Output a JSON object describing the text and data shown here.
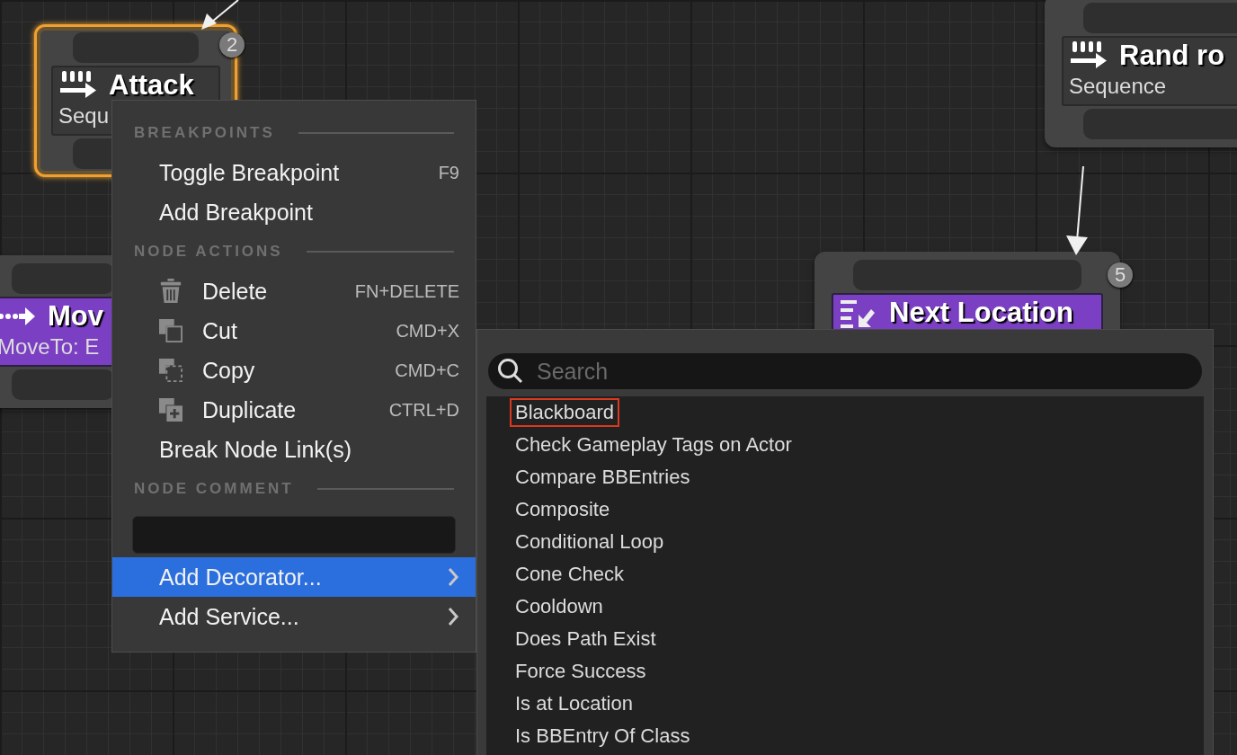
{
  "graph_nodes": [
    {
      "kind": "composite",
      "title": "Attack",
      "subtitle": "Sequ",
      "badge": "2",
      "selected": true
    },
    {
      "kind": "composite",
      "title": "Rand ro",
      "subtitle": "Sequence",
      "selected": false
    },
    {
      "kind": "move_task",
      "title": "Mov",
      "subtitle": "MoveTo: E",
      "selected": false
    },
    {
      "kind": "task",
      "title": "Next Location",
      "badge": "5",
      "selected": false
    }
  ],
  "context_menu": {
    "sections": [
      {
        "kind": "actions",
        "heading": "BREAKPOINTS",
        "items": [
          {
            "label": "Toggle Breakpoint",
            "shortcut": "F9",
            "with_icon": false,
            "selected": false
          },
          {
            "label": "Add Breakpoint",
            "with_icon": false,
            "selected": false
          }
        ]
      },
      {
        "kind": "actions",
        "heading": "NODE ACTIONS",
        "items": [
          {
            "label": "Delete",
            "shortcut": "FN+DELETE",
            "with_icon": true,
            "selected": false
          },
          {
            "label": "Cut",
            "shortcut": "CMD+X",
            "with_icon": true,
            "selected": false
          },
          {
            "label": "Copy",
            "shortcut": "CMD+C",
            "with_icon": true,
            "selected": false
          },
          {
            "label": "Duplicate",
            "shortcut": "CTRL+D",
            "with_icon": true,
            "selected": false
          },
          {
            "label": "Break Node Link(s)",
            "with_icon": false,
            "selected": false
          }
        ]
      },
      {
        "kind": "comment",
        "heading": "NODE COMMENT"
      },
      {
        "kind": "submenus",
        "items": [
          {
            "label": "Add Decorator...",
            "submenu": true,
            "selected": true
          },
          {
            "label": "Add Service...",
            "submenu": true,
            "selected": false
          }
        ]
      }
    ]
  },
  "decorator_menu": {
    "search": {
      "placeholder": "Search"
    },
    "items": [
      {
        "label": "Blackboard",
        "highlighted": true
      },
      {
        "label": "Check Gameplay Tags on Actor",
        "highlighted": false
      },
      {
        "label": "Compare BBEntries",
        "highlighted": false
      },
      {
        "label": "Composite",
        "highlighted": false
      },
      {
        "label": "Conditional Loop",
        "highlighted": false
      },
      {
        "label": "Cone Check",
        "highlighted": false
      },
      {
        "label": "Cooldown",
        "highlighted": false
      },
      {
        "label": "Does Path Exist",
        "highlighted": false
      },
      {
        "label": "Force Success",
        "highlighted": false
      },
      {
        "label": "Is at Location",
        "highlighted": false
      },
      {
        "label": "Is BBEntry Of Class",
        "highlighted": false
      }
    ]
  }
}
